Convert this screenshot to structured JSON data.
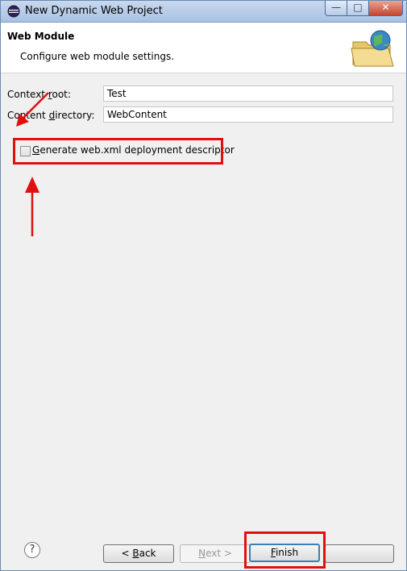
{
  "window": {
    "title": "New Dynamic Web Project"
  },
  "banner": {
    "title": "Web Module",
    "description": "Configure web module settings."
  },
  "form": {
    "context_root": {
      "label_pre": "Context ",
      "label_u": "r",
      "label_post": "oot:",
      "value": "Test"
    },
    "content_directory": {
      "label_pre": "Conten",
      "label_mid": "t ",
      "label_u": "d",
      "label_post": "irectory:",
      "value": "WebContent"
    },
    "generate_descriptor": {
      "label_u": "G",
      "label_post": "enerate web.xml deployment descriptor",
      "checked": false
    }
  },
  "footer": {
    "help_symbol": "?",
    "back": {
      "prefix": "< ",
      "u": "B",
      "rest": "ack"
    },
    "next": {
      "u": "N",
      "rest": "ext >"
    },
    "finish": {
      "u": "F",
      "rest": "inish"
    }
  },
  "icons": {
    "app": "eclipse-icon",
    "banner": "web-folder-globe-icon",
    "help": "help-icon"
  },
  "colors": {
    "highlight": "#e01010",
    "title_bar": "#b5cbe7"
  }
}
